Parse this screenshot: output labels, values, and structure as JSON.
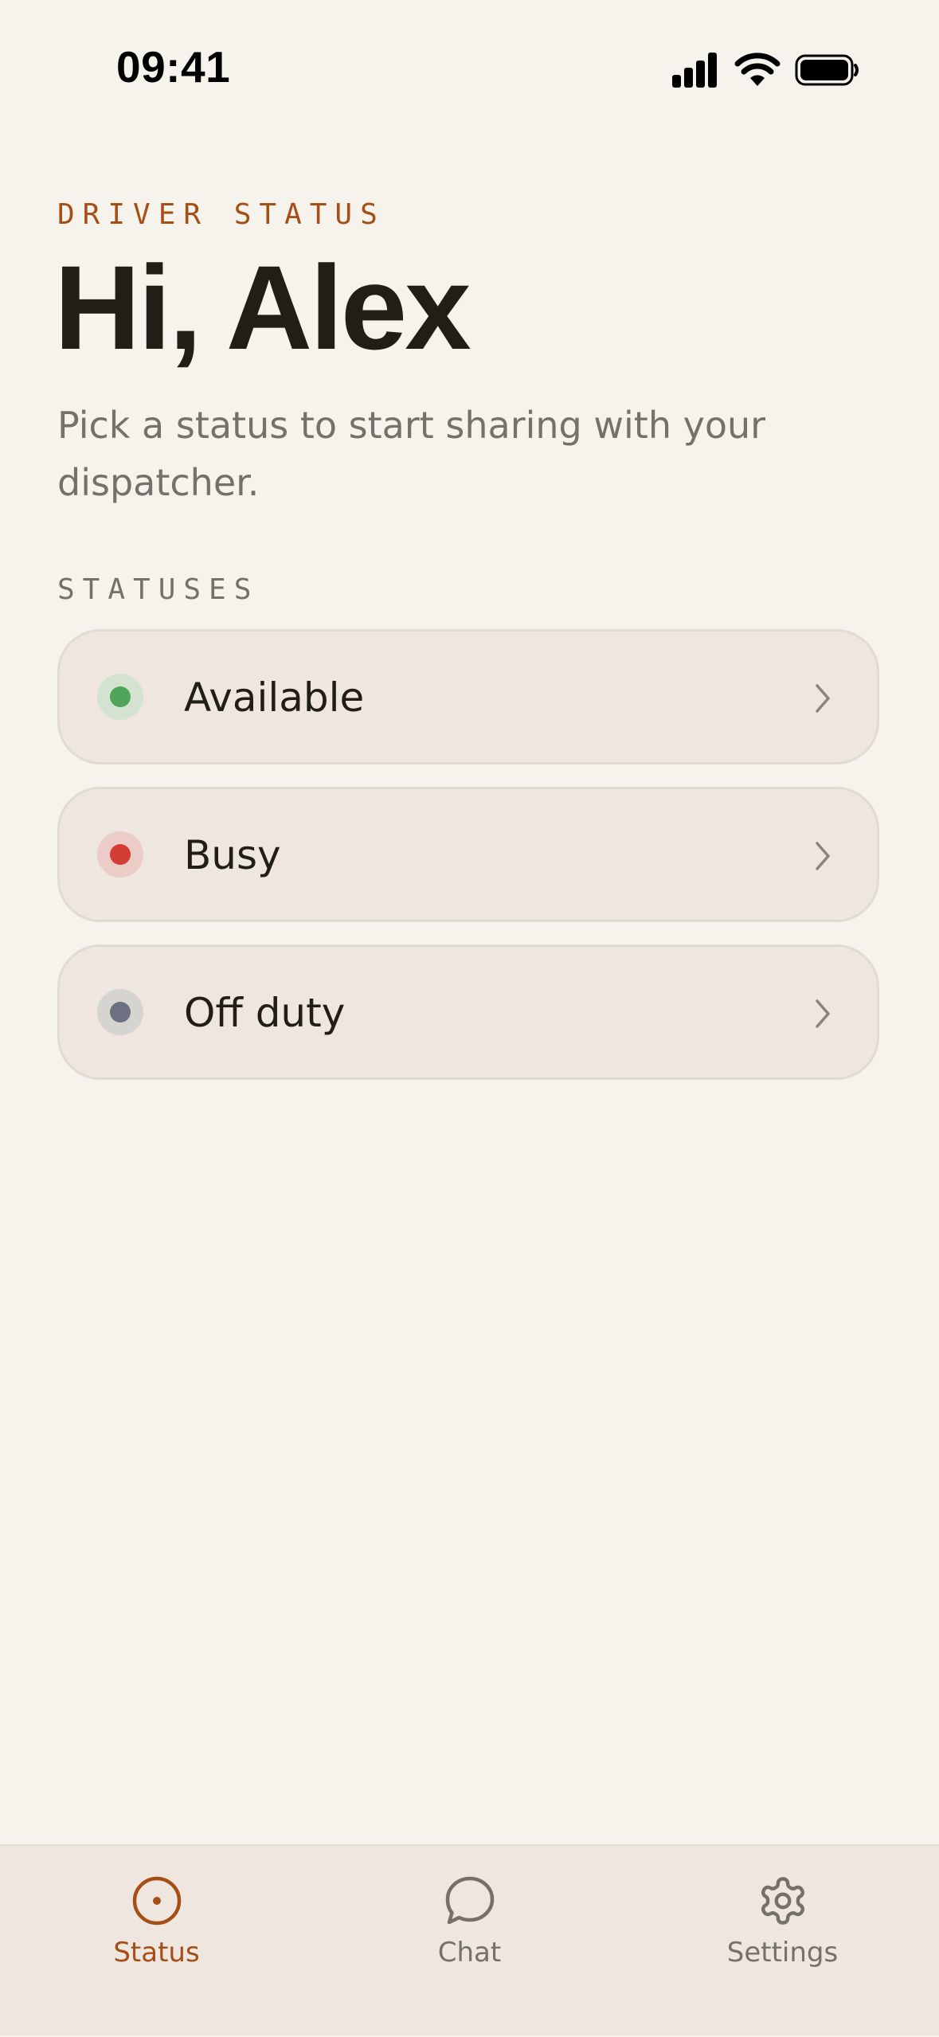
{
  "status_bar": {
    "time": "09:41",
    "icons": [
      "cellular-signal-icon",
      "wifi-icon",
      "battery-icon"
    ]
  },
  "header": {
    "eyebrow": "DRIVER STATUS",
    "greeting": "Hi, Alex",
    "subtitle": "Pick a status to start sharing with your dispatcher."
  },
  "statuses": {
    "section_label": "STATUSES",
    "items": [
      {
        "label": "Available",
        "dot_color": "#4fa55a",
        "halo_color": "#d4e2d0",
        "icon": "chevron-right-icon"
      },
      {
        "label": "Busy",
        "dot_color": "#d23d36",
        "halo_color": "#ecccc6",
        "icon": "chevron-right-icon"
      },
      {
        "label": "Off duty",
        "dot_color": "#6c7080",
        "halo_color": "#d6d4d0",
        "icon": "chevron-right-icon"
      }
    ]
  },
  "tab_bar": {
    "tabs": [
      {
        "label": "Status",
        "icon": "target-circle-icon",
        "active": true
      },
      {
        "label": "Chat",
        "icon": "chat-bubble-icon",
        "active": false
      },
      {
        "label": "Settings",
        "icon": "gear-icon",
        "active": false
      }
    ]
  },
  "colors": {
    "background": "#f6f2ec",
    "card_background": "#efe7df",
    "accent": "#a54f16",
    "text_primary": "#211d17",
    "text_secondary": "#76706a"
  }
}
